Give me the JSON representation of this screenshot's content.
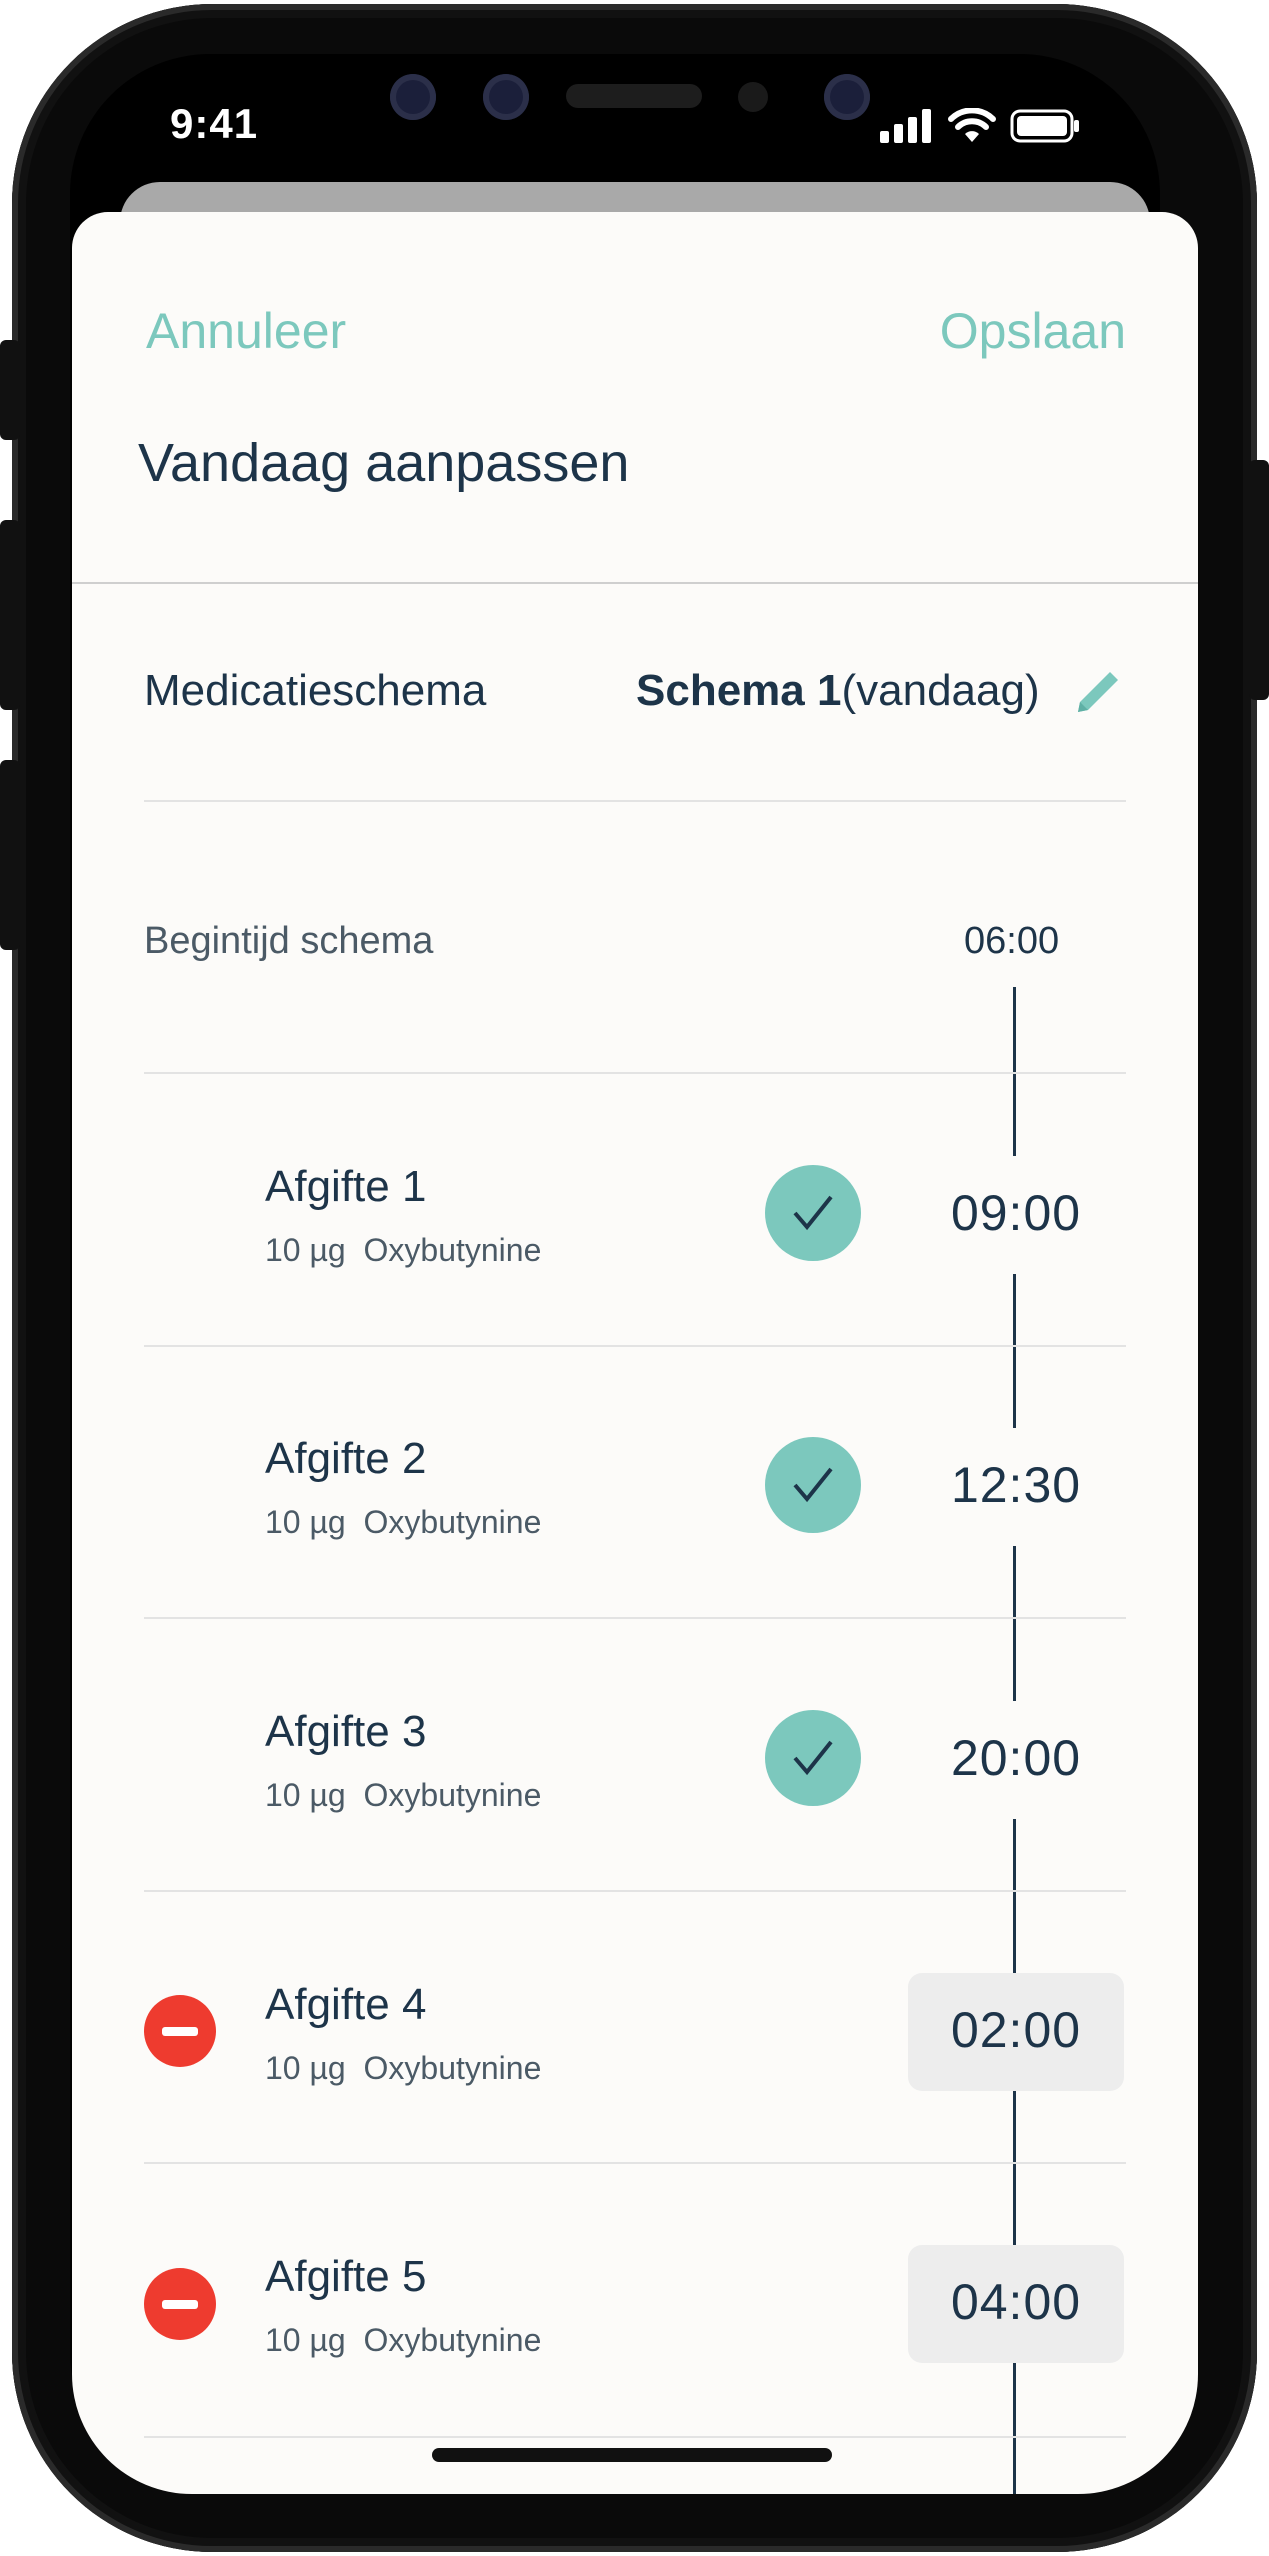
{
  "status_bar": {
    "time": "9:41"
  },
  "header": {
    "cancel_label": "Annuleer",
    "save_label": "Opslaan",
    "title": "Vandaag aanpassen"
  },
  "schema": {
    "label": "Medicatieschema",
    "value_bold": "Schema 1",
    "value_suffix": "(vandaag)"
  },
  "start_time": {
    "label": "Begintijd schema",
    "value": "06:00"
  },
  "doses": [
    {
      "name": "Afgifte 1",
      "amount": "10 µg",
      "medication": "Oxybutynine",
      "time": "09:00",
      "state": "done"
    },
    {
      "name": "Afgifte 2",
      "amount": "10 µg",
      "medication": "Oxybutynine",
      "time": "12:30",
      "state": "done"
    },
    {
      "name": "Afgifte 3",
      "amount": "10 µg",
      "medication": "Oxybutynine",
      "time": "20:00",
      "state": "done"
    },
    {
      "name": "Afgifte 4",
      "amount": "10 µg",
      "medication": "Oxybutynine",
      "time": "02:00",
      "state": "editable"
    },
    {
      "name": "Afgifte 5",
      "amount": "10 µg",
      "medication": "Oxybutynine",
      "time": "04:00",
      "state": "editable"
    }
  ],
  "colors": {
    "accent": "#7cc8bd",
    "text": "#1d3449",
    "delete": "#ee3b2f",
    "background": "#fcfbf9"
  }
}
